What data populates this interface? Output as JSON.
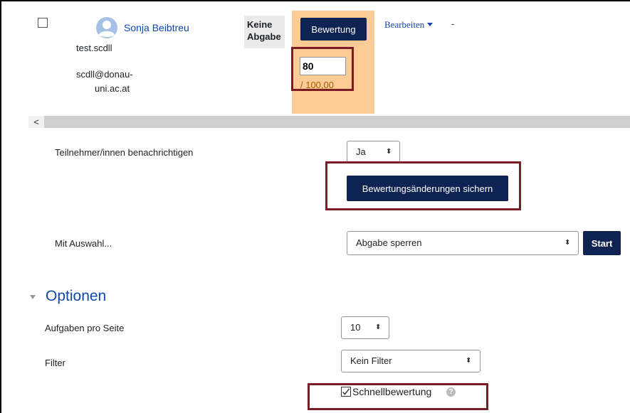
{
  "participant": {
    "name": "Sonja Beibtreu",
    "username": "test.scdll",
    "email_line1": "scdll@donau-",
    "email_line2": "uni.ac.at",
    "status": "Keine Abgabe"
  },
  "grading": {
    "button_label": "Bewertung",
    "grade_value": "80",
    "grade_max": "/ 100,00"
  },
  "actions": {
    "edit_label": "Bearbeiten",
    "dash": "-"
  },
  "scroll": {
    "left_arrow": "<"
  },
  "notify": {
    "label": "Teilnehmer/innen benachrichtigen",
    "value": "Ja"
  },
  "save": {
    "label": "Bewertungsänderungen sichern"
  },
  "bulk": {
    "label": "Mit Auswahl...",
    "value": "Abgabe sperren",
    "start_label": "Start"
  },
  "options": {
    "title": "Optionen",
    "per_page_label": "Aufgaben pro Seite",
    "per_page_value": "10",
    "filter_label": "Filter",
    "filter_value": "Kein Filter",
    "quickgrading_label": "Schnellbewertung",
    "help_glyph": "?"
  },
  "colors": {
    "primary_button": "#0f2352",
    "link": "#0f47ad",
    "grade_column": "#fdcb95",
    "highlight_border": "#7b1b24"
  }
}
